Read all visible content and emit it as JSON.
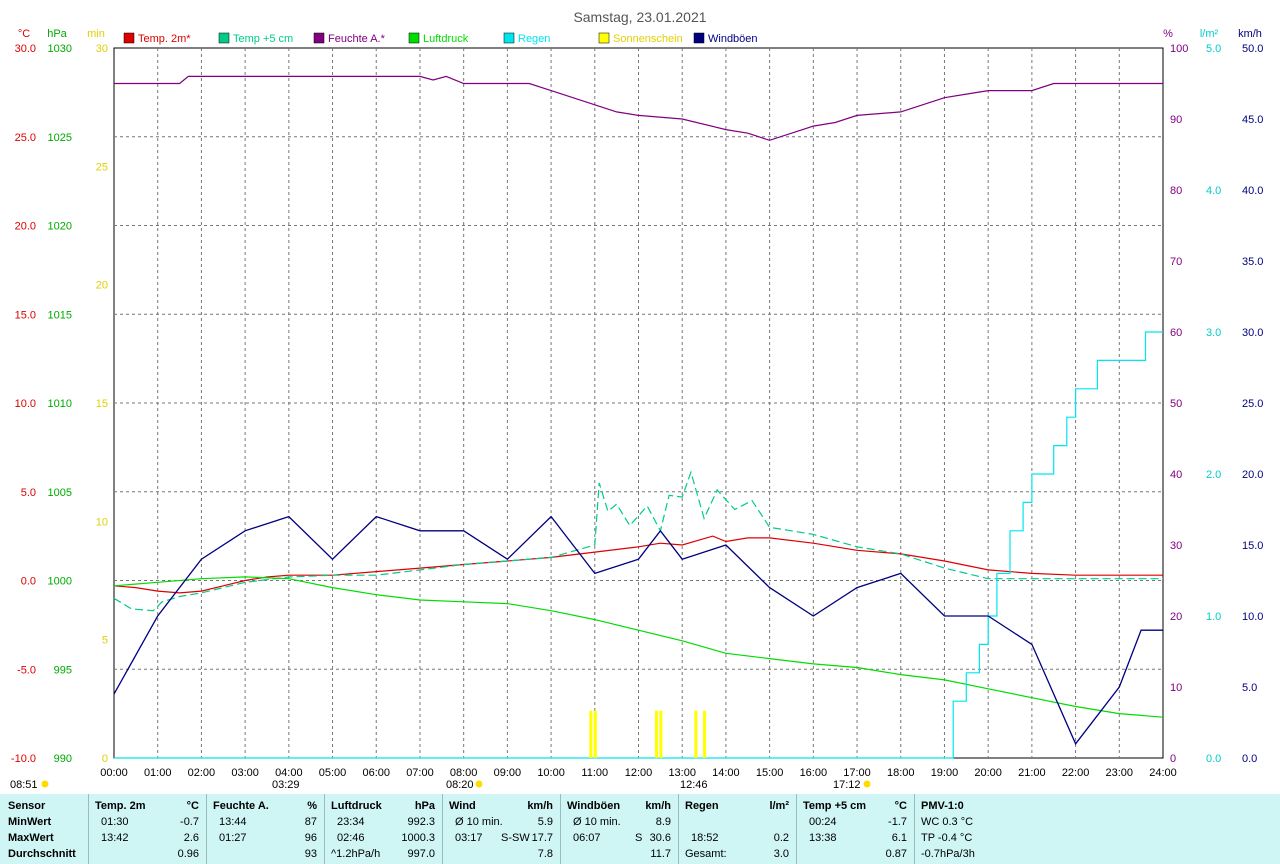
{
  "title": "Samstag, 23.01.2021",
  "units": {
    "temp": "°C",
    "press": "hPa",
    "sun": "min",
    "hum": "%",
    "rain": "l/m²",
    "wind": "km/h"
  },
  "legend": [
    {
      "label": "Temp. 2m*",
      "color": "#dd0000"
    },
    {
      "label": "Temp +5 cm",
      "color": "#00cc88"
    },
    {
      "label": "Feuchte A.*",
      "color": "#800080"
    },
    {
      "label": "Luftdruck",
      "color": "#00dd00"
    },
    {
      "label": "Regen",
      "color": "#00e5ee"
    },
    {
      "label": "Sonnenschein",
      "color": "#ffff00"
    },
    {
      "label": "Windböen",
      "color": "#000080"
    }
  ],
  "markers": {
    "min_left": "08:51",
    "sunrise": "08:20",
    "sunset": "17:12",
    "temp_min": "03:29",
    "temp_max": "12:46"
  },
  "chart_data": {
    "type": "line",
    "x_range": [
      "00:00",
      "24:00"
    ],
    "x_ticks": [
      "00:00",
      "01:00",
      "02:00",
      "03:00",
      "04:00",
      "05:00",
      "06:00",
      "07:00",
      "08:00",
      "09:00",
      "10:00",
      "11:00",
      "12:00",
      "13:00",
      "14:00",
      "15:00",
      "16:00",
      "17:00",
      "18:00",
      "19:00",
      "20:00",
      "21:00",
      "22:00",
      "23:00",
      "24:00"
    ],
    "axes": {
      "temp": {
        "label": "°C",
        "min": -10,
        "max": 30,
        "ticks": [
          "30.0",
          "25.0",
          "20.0",
          "15.0",
          "10.0",
          "5.0",
          "0.0",
          "-5.0",
          "-10.0"
        ]
      },
      "pressure": {
        "label": "hPa",
        "min": 990,
        "max": 1030,
        "ticks": [
          "1030",
          "1025",
          "1020",
          "1015",
          "1010",
          "1005",
          "1000",
          "995",
          "990"
        ]
      },
      "sunshine": {
        "label": "min",
        "min": 0,
        "max": 30,
        "ticks": [
          "30",
          "25",
          "20",
          "15",
          "10",
          "5",
          "0"
        ]
      },
      "humidity": {
        "label": "%",
        "min": 0,
        "max": 100,
        "ticks": [
          "100",
          "90",
          "80",
          "70",
          "60",
          "50",
          "40",
          "30",
          "20",
          "10",
          "0"
        ]
      },
      "rain": {
        "label": "l/m²",
        "min": 0,
        "max": 5,
        "ticks": [
          "5.0",
          "4.0",
          "3.0",
          "2.0",
          "1.0",
          "0.0"
        ]
      },
      "wind": {
        "label": "km/h",
        "min": 0,
        "max": 50,
        "ticks": [
          "50.0",
          "45.0",
          "40.0",
          "35.0",
          "30.0",
          "25.0",
          "20.0",
          "15.0",
          "10.0",
          "5.0",
          "0.0"
        ]
      }
    },
    "series": [
      {
        "name": "Temp. 2m*",
        "axis": "temp",
        "color": "#dd0000",
        "points": [
          [
            0,
            -0.3
          ],
          [
            0.5,
            -0.4
          ],
          [
            1,
            -0.6
          ],
          [
            1.5,
            -0.7
          ],
          [
            2,
            -0.6
          ],
          [
            2.5,
            -0.3
          ],
          [
            3,
            0
          ],
          [
            3.5,
            0.2
          ],
          [
            4,
            0.3
          ],
          [
            5,
            0.3
          ],
          [
            6,
            0.5
          ],
          [
            7,
            0.7
          ],
          [
            8,
            0.9
          ],
          [
            9,
            1.1
          ],
          [
            10,
            1.3
          ],
          [
            11,
            1.6
          ],
          [
            12,
            1.9
          ],
          [
            12.5,
            2.1
          ],
          [
            13,
            2
          ],
          [
            13.7,
            2.5
          ],
          [
            14,
            2.2
          ],
          [
            14.5,
            2.4
          ],
          [
            15,
            2.4
          ],
          [
            16,
            2.1
          ],
          [
            17,
            1.7
          ],
          [
            18,
            1.5
          ],
          [
            19,
            1.1
          ],
          [
            20,
            0.6
          ],
          [
            21,
            0.4
          ],
          [
            22,
            0.3
          ],
          [
            23,
            0.3
          ],
          [
            24,
            0.3
          ]
        ]
      },
      {
        "name": "Temp +5 cm",
        "axis": "temp",
        "color": "#00cc88",
        "points": [
          [
            0,
            -1
          ],
          [
            0.4,
            -1.6
          ],
          [
            0.9,
            -1.7
          ],
          [
            1.1,
            -1.2
          ],
          [
            1.5,
            -0.9
          ],
          [
            2,
            -0.7
          ],
          [
            3,
            -0.1
          ],
          [
            4,
            0.2
          ],
          [
            5,
            0.3
          ],
          [
            6,
            0.3
          ],
          [
            7,
            0.6
          ],
          [
            8,
            0.9
          ],
          [
            9,
            1.1
          ],
          [
            10,
            1.3
          ],
          [
            11,
            2
          ],
          [
            11.1,
            5.5
          ],
          [
            11.3,
            3.9
          ],
          [
            11.5,
            4.3
          ],
          [
            11.8,
            3.1
          ],
          [
            12.2,
            4.2
          ],
          [
            12.5,
            2.8
          ],
          [
            12.7,
            4.8
          ],
          [
            13,
            4.7
          ],
          [
            13.2,
            6.1
          ],
          [
            13.5,
            3.5
          ],
          [
            13.8,
            5.1
          ],
          [
            14.2,
            4
          ],
          [
            14.6,
            4.5
          ],
          [
            15,
            3
          ],
          [
            15.5,
            2.8
          ],
          [
            16,
            2.6
          ],
          [
            17,
            1.9
          ],
          [
            18,
            1.5
          ],
          [
            19,
            0.7
          ],
          [
            20,
            0.1
          ],
          [
            22,
            0.1
          ],
          [
            24,
            0.1
          ]
        ]
      },
      {
        "name": "Feuchte A.*",
        "axis": "humidity",
        "color": "#800080",
        "points": [
          [
            0,
            95
          ],
          [
            1.5,
            95
          ],
          [
            1.7,
            96
          ],
          [
            2,
            96
          ],
          [
            3,
            96
          ],
          [
            4,
            96
          ],
          [
            5,
            96
          ],
          [
            6,
            96
          ],
          [
            7,
            96
          ],
          [
            7.3,
            95.5
          ],
          [
            7.6,
            96
          ],
          [
            8,
            95
          ],
          [
            9,
            95
          ],
          [
            9.5,
            95
          ],
          [
            10,
            94
          ],
          [
            11,
            92
          ],
          [
            11.5,
            91
          ],
          [
            12,
            90.5
          ],
          [
            13,
            90
          ],
          [
            14,
            88.5
          ],
          [
            14.5,
            88
          ],
          [
            15,
            87
          ],
          [
            15.5,
            88
          ],
          [
            16,
            89
          ],
          [
            16.5,
            89.5
          ],
          [
            17,
            90.5
          ],
          [
            18,
            91
          ],
          [
            18.5,
            92
          ],
          [
            19,
            93
          ],
          [
            19.5,
            93.5
          ],
          [
            20,
            94
          ],
          [
            21,
            94
          ],
          [
            21.5,
            95
          ],
          [
            24,
            95
          ]
        ]
      },
      {
        "name": "Luftdruck",
        "axis": "pressure",
        "color": "#00dd00",
        "points": [
          [
            0,
            999.7
          ],
          [
            1,
            999.9
          ],
          [
            2,
            1000.1
          ],
          [
            3,
            1000.2
          ],
          [
            4,
            1000.1
          ],
          [
            5,
            999.6
          ],
          [
            6,
            999.2
          ],
          [
            7,
            998.9
          ],
          [
            8,
            998.8
          ],
          [
            9,
            998.7
          ],
          [
            10,
            998.3
          ],
          [
            11,
            997.8
          ],
          [
            12,
            997.2
          ],
          [
            13,
            996.6
          ],
          [
            14,
            995.9
          ],
          [
            15,
            995.6
          ],
          [
            16,
            995.3
          ],
          [
            17,
            995.1
          ],
          [
            18,
            994.7
          ],
          [
            19,
            994.4
          ],
          [
            20,
            993.9
          ],
          [
            21,
            993.4
          ],
          [
            22,
            992.9
          ],
          [
            23,
            992.5
          ],
          [
            24,
            992.3
          ]
        ]
      },
      {
        "name": "Regen",
        "axis": "rain",
        "color": "#00e5ee",
        "points": [
          [
            0,
            0
          ],
          [
            18.9,
            0
          ],
          [
            19.2,
            0.4
          ],
          [
            19.5,
            0.6
          ],
          [
            19.8,
            0.8
          ],
          [
            20,
            1
          ],
          [
            20.2,
            1.3
          ],
          [
            20.5,
            1.6
          ],
          [
            20.8,
            1.8
          ],
          [
            21,
            2
          ],
          [
            21.5,
            2.2
          ],
          [
            21.8,
            2.4
          ],
          [
            22,
            2.6
          ],
          [
            22.5,
            2.8
          ],
          [
            23.5,
            2.8
          ],
          [
            23.6,
            3
          ],
          [
            24,
            3
          ]
        ]
      },
      {
        "name": "Sonnenschein",
        "axis": "sunshine",
        "color": "#ffff00",
        "bars": [
          [
            10.9,
            2
          ],
          [
            11,
            2
          ],
          [
            12.4,
            2
          ],
          [
            12.5,
            2
          ],
          [
            13.3,
            2
          ],
          [
            13.5,
            2
          ]
        ]
      },
      {
        "name": "Windböen",
        "axis": "wind",
        "color": "#000080",
        "points": [
          [
            0,
            4.5
          ],
          [
            1,
            10
          ],
          [
            2,
            14
          ],
          [
            3,
            16
          ],
          [
            4,
            17
          ],
          [
            5,
            14
          ],
          [
            6,
            17
          ],
          [
            7,
            16
          ],
          [
            8,
            16
          ],
          [
            9,
            14
          ],
          [
            10,
            17
          ],
          [
            11,
            13
          ],
          [
            12,
            14
          ],
          [
            12.5,
            16
          ],
          [
            13,
            14
          ],
          [
            14,
            15
          ],
          [
            15,
            12
          ],
          [
            16,
            10
          ],
          [
            17,
            12
          ],
          [
            18,
            13
          ],
          [
            19,
            10
          ],
          [
            20,
            10
          ],
          [
            21,
            8
          ],
          [
            22,
            1
          ],
          [
            23,
            5
          ],
          [
            23.5,
            9
          ],
          [
            24,
            9
          ]
        ]
      }
    ]
  },
  "stats": {
    "sensor": {
      "header": "Sensor",
      "rows": [
        "MinWert",
        "MaxWert",
        "Durchschnitt"
      ]
    },
    "temp2m": {
      "header": "Temp. 2m",
      "unit": "°C",
      "times": [
        "01:30",
        "13:42",
        ""
      ],
      "values": [
        "-0.7",
        "2.6",
        "0.96"
      ]
    },
    "feuchte": {
      "header": "Feuchte A.",
      "unit": "%",
      "times": [
        "13:44",
        "01:27",
        ""
      ],
      "values": [
        "87",
        "96",
        "93"
      ]
    },
    "luftdruck": {
      "header": "Luftdruck",
      "unit": "hPa",
      "times": [
        "23:34",
        "02:46",
        "^1.2hPa/h"
      ],
      "values": [
        "992.3",
        "1000.3",
        "997.0"
      ]
    },
    "wind": {
      "header": "Wind",
      "unit": "km/h",
      "times": [
        "Ø 10 min.",
        "03:17",
        ""
      ],
      "dirs": [
        "",
        "S-SW",
        ""
      ],
      "values": [
        "5.9",
        "17.7",
        "7.8"
      ]
    },
    "windboeen": {
      "header": "Windböen",
      "unit": "km/h",
      "times": [
        "Ø 10 min.",
        "06:07",
        ""
      ],
      "dirs": [
        "",
        "S",
        ""
      ],
      "values": [
        "8.9",
        "30.6",
        "11.7"
      ]
    },
    "regen": {
      "header": "Regen",
      "unit": "l/m²",
      "times": [
        "",
        "18:52",
        "Gesamt:"
      ],
      "values": [
        "",
        "0.2",
        "3.0"
      ]
    },
    "temp5cm": {
      "header": "Temp +5 cm",
      "unit": "°C",
      "times": [
        "00:24",
        "13:38",
        ""
      ],
      "values": [
        "-1.7",
        "6.1",
        "0.87"
      ]
    },
    "pmv": {
      "header": "PMV-1:0",
      "rows": [
        "WC 0.3 °C",
        "TP -0.4 °C",
        "-0.7hPa/3h"
      ]
    }
  }
}
